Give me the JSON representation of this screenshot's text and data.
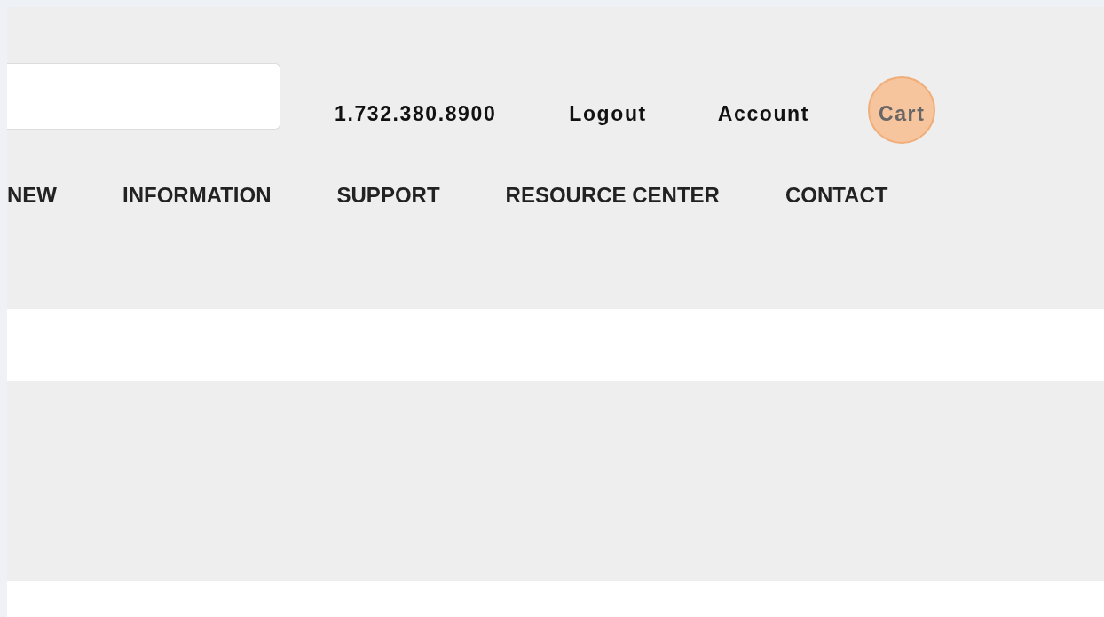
{
  "header": {
    "phone": "1.732.380.8900",
    "links": [
      {
        "label": "Logout",
        "highlighted": false
      },
      {
        "label": "Account",
        "highlighted": false
      },
      {
        "label": "Cart",
        "highlighted": true
      }
    ]
  },
  "nav": [
    "NEW",
    "INFORMATION",
    "SUPPORT",
    "RESOURCE CENTER",
    "CONTACT"
  ]
}
